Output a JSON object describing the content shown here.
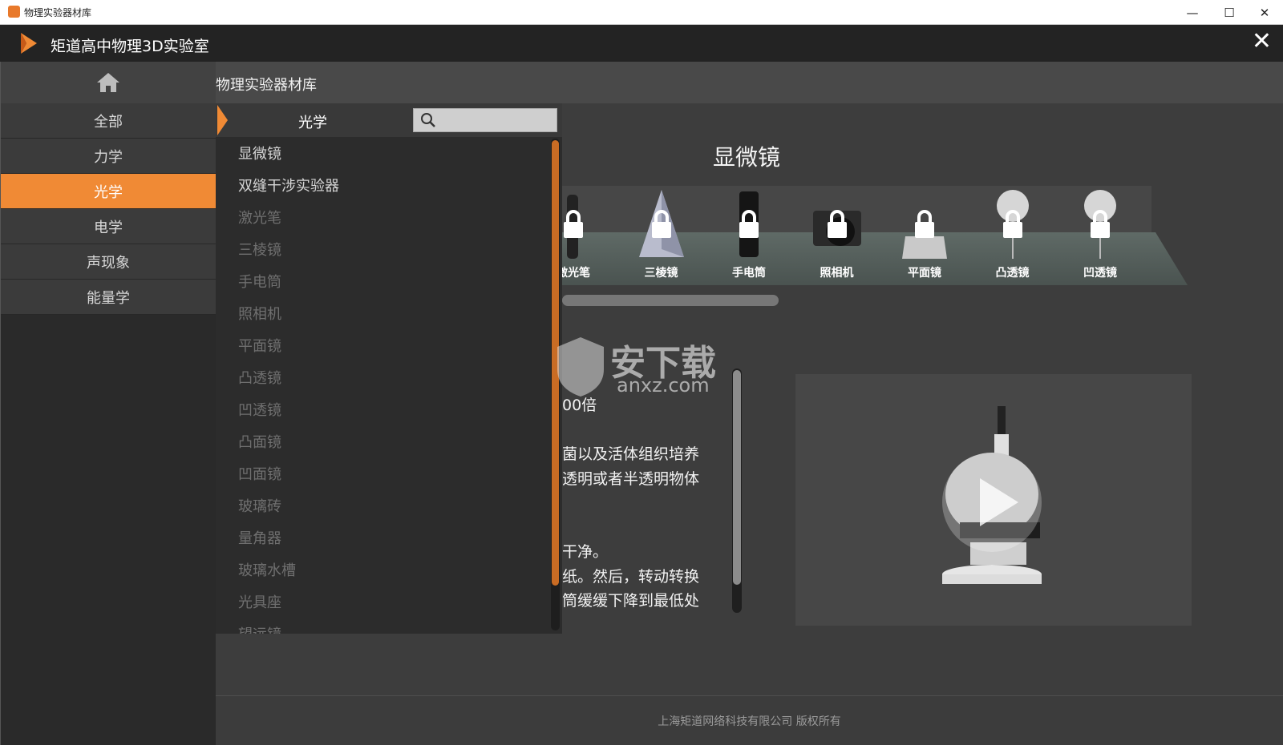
{
  "window": {
    "title": "物理实验器材库",
    "minimize": "—",
    "maximize": "☐",
    "close": "✕"
  },
  "app": {
    "title": "矩道高中物理3D实验室",
    "close_glyph": "✕"
  },
  "breadcrumb": "物理实验器材库",
  "categories": [
    {
      "label": "全部",
      "active": false
    },
    {
      "label": "力学",
      "active": false
    },
    {
      "label": "光学",
      "active": true
    },
    {
      "label": "电学",
      "active": false
    },
    {
      "label": "声现象",
      "active": false
    },
    {
      "label": "能量学",
      "active": false
    }
  ],
  "panel": {
    "category": "光学",
    "search_placeholder": ""
  },
  "equipment_list": [
    {
      "label": "显微镜",
      "enabled": true
    },
    {
      "label": "双缝干涉实验器",
      "enabled": true
    },
    {
      "label": "激光笔",
      "enabled": false
    },
    {
      "label": "三棱镜",
      "enabled": false
    },
    {
      "label": "手电筒",
      "enabled": false
    },
    {
      "label": "照相机",
      "enabled": false
    },
    {
      "label": "平面镜",
      "enabled": false
    },
    {
      "label": "凸透镜",
      "enabled": false
    },
    {
      "label": "凹透镜",
      "enabled": false
    },
    {
      "label": "凸面镜",
      "enabled": false
    },
    {
      "label": "凹面镜",
      "enabled": false
    },
    {
      "label": "玻璃砖",
      "enabled": false
    },
    {
      "label": "量角器",
      "enabled": false
    },
    {
      "label": "玻璃水槽",
      "enabled": false
    },
    {
      "label": "光具座",
      "enabled": false
    },
    {
      "label": "望远镜",
      "enabled": false
    }
  ],
  "detail": {
    "title": "显微镜",
    "description_lines": [
      "00倍",
      "",
      "菌以及活体组织培养",
      "透明或者半透明物体",
      "",
      "",
      "干净。",
      "纸。然后，转动转换",
      "筒缓缓下降到最低处"
    ]
  },
  "shelf_items": [
    {
      "label": "激光笔",
      "icon": "laser-pointer-icon"
    },
    {
      "label": "三棱镜",
      "icon": "prism-icon"
    },
    {
      "label": "手电筒",
      "icon": "flashlight-icon"
    },
    {
      "label": "照相机",
      "icon": "camera-icon"
    },
    {
      "label": "平面镜",
      "icon": "plane-mirror-icon"
    },
    {
      "label": "凸透镜",
      "icon": "convex-lens-icon"
    },
    {
      "label": "凹透镜",
      "icon": "concave-lens-icon"
    }
  ],
  "watermark": {
    "text": "安下载",
    "sub": "anxz.com"
  },
  "footer": {
    "copyright": "上海矩道网络科技有限公司  版权所有"
  },
  "colors": {
    "accent": "#f08a35",
    "background": "#3d3d3d",
    "panel": "#2c2c2c"
  }
}
